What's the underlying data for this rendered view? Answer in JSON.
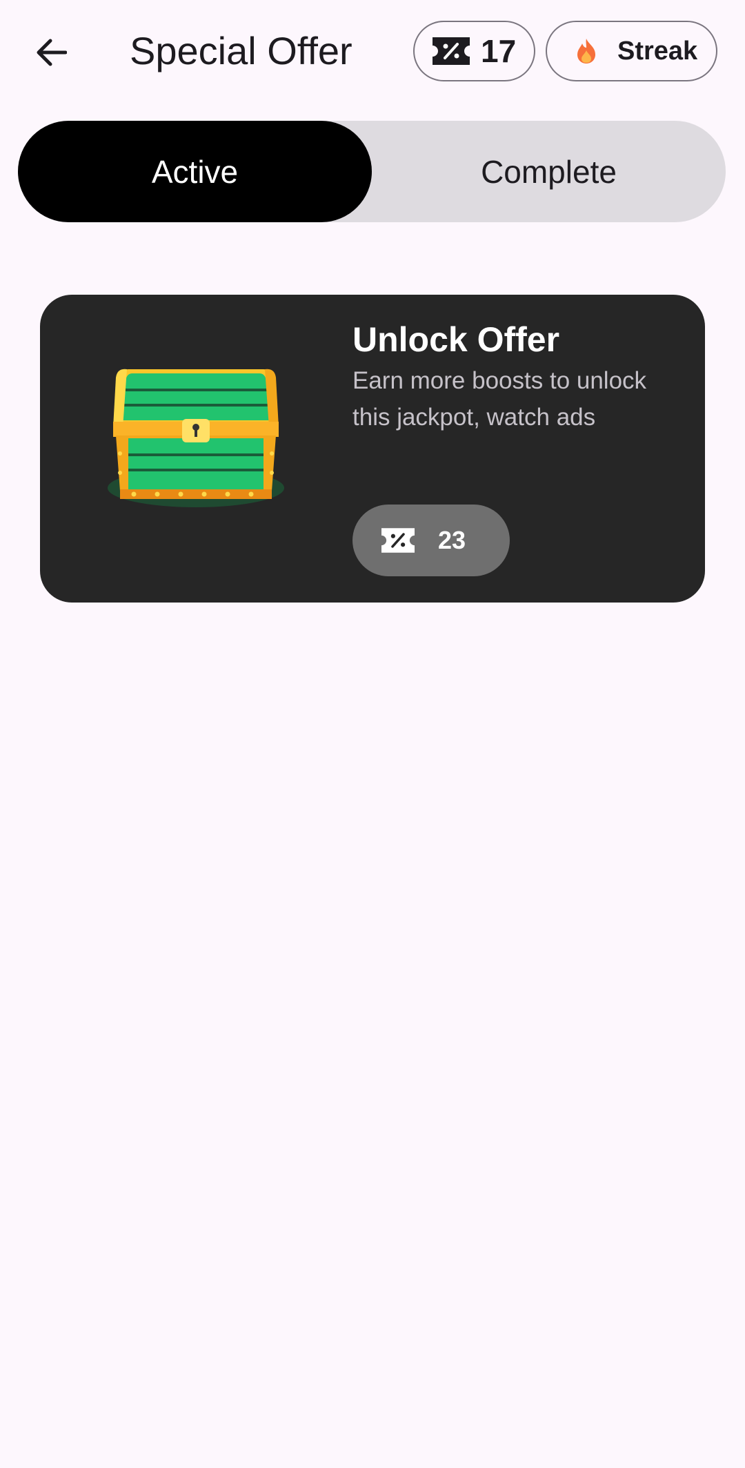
{
  "header": {
    "title": "Special Offer",
    "back_icon": "arrow-left-icon",
    "coupons": {
      "icon": "percent-ticket-icon",
      "count": "17"
    },
    "streak": {
      "icon": "flame-icon",
      "label": "Streak"
    }
  },
  "tabs": [
    {
      "label": "Active",
      "selected": true
    },
    {
      "label": "Complete",
      "selected": false
    }
  ],
  "offers": [
    {
      "icon": "treasure-chest-icon",
      "title": "Unlock Offer",
      "description": "Earn more boosts to unlock this jackpot, watch ads",
      "cost_icon": "percent-ticket-icon",
      "cost": "23"
    }
  ],
  "colors": {
    "background": "#fdf7fd",
    "tab_active_bg": "#000000",
    "tab_track_bg": "#dedbe0",
    "card_bg": "#262626",
    "cost_pill_bg": "#6f6f6f",
    "chest_green": "#22c36e",
    "chest_gold": "#fbc62a"
  }
}
